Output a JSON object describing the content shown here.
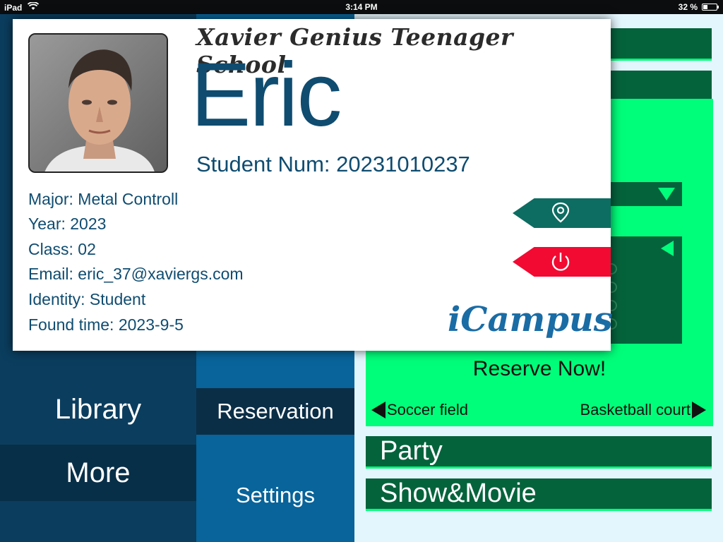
{
  "status_bar": {
    "device": "iPad",
    "time": "3:14 PM",
    "battery": "32 %"
  },
  "sidebar": {
    "library": "Library",
    "more": "More"
  },
  "menu": {
    "reservation": "Reservation",
    "settings": "Settings"
  },
  "main": {
    "reserve_label": "Reserve Now!",
    "field_prev": "Soccer field",
    "field_next": "Basketball court",
    "party": "Party",
    "show_movie": "Show&Movie"
  },
  "profile": {
    "school": "Xavier Genius Teenager School",
    "name": "Eric",
    "student_num": "Student Num: 20231010237",
    "major": "Major: Metal Controll",
    "year": "Year: 2023",
    "class": "Class: 02",
    "email": "Email: eric_37@xaviergs.com",
    "identity": "Identity: Student",
    "found_time": "Found time: 2023-9-5",
    "brand": "iCampus"
  },
  "colors": {
    "nav_dark": "#0b3d5e",
    "nav_mid": "#08649a",
    "accent_green": "#00fe7a",
    "bar_green": "#05633c",
    "name_blue": "#0f4c70",
    "location_tab": "#0d6d62",
    "power_tab": "#f20a32"
  },
  "icons": [
    "wifi-icon",
    "battery-icon",
    "location-pin-icon",
    "power-icon",
    "dropdown-arrow-icon",
    "collapse-arrow-icon",
    "prev-arrow-icon",
    "next-arrow-icon"
  ]
}
